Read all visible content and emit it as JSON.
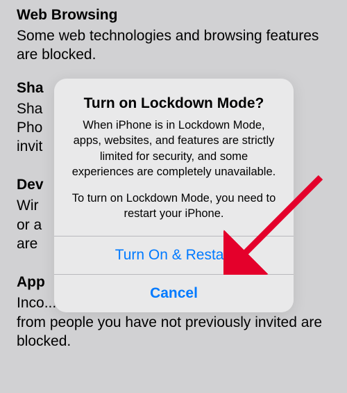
{
  "background": {
    "sections": [
      {
        "title": "Web Browsing",
        "body": "Some web technologies and browsing features are blocked."
      },
      {
        "title": "Sha",
        "body": "Sha                                                           he Pho invit"
      },
      {
        "title": "Dev",
        "body": "Wir                                                             e or a                                                          ed are"
      },
      {
        "title": "App",
        "body": "Inco.....g ................... ... . .pp.. ... .....s from people you have not previously invited are blocked."
      }
    ]
  },
  "alert": {
    "title": "Turn on Lockdown Mode?",
    "message": "When iPhone is in Lockdown Mode, apps, websites, and features are strictly limited for security, and some experiences are completely unavailable.",
    "submessage": "To turn on Lockdown Mode, you need to restart your iPhone.",
    "primary_button": "Turn On & Restart",
    "cancel_button": "Cancel"
  }
}
